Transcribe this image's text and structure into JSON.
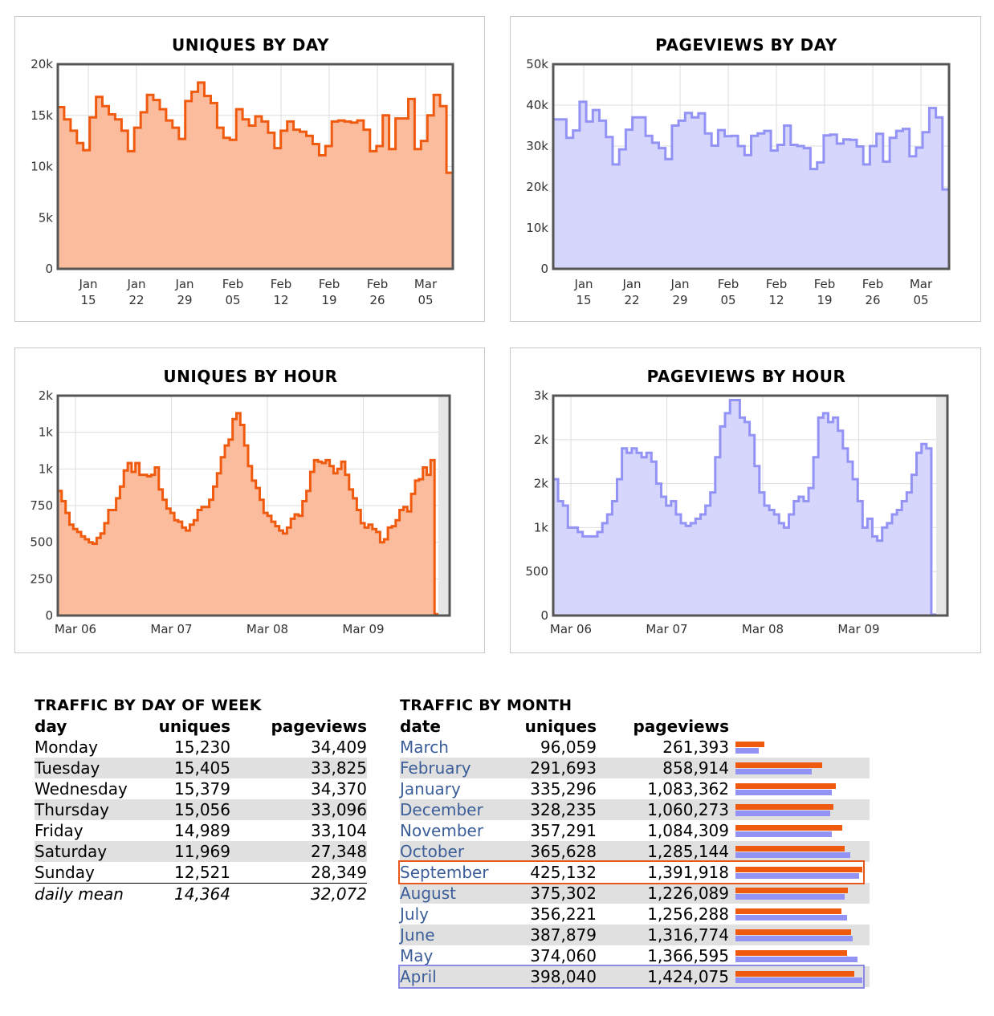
{
  "colors": {
    "uniques_line": "#f05a0e",
    "uniques_fill": "#fbbc9d",
    "pageviews_line": "#9393f5",
    "pageviews_fill": "#d6d6fd"
  },
  "chart_data": [
    {
      "id": "uniques_day",
      "type": "area",
      "title": "UNIQUES BY DAY",
      "yticks": [
        "0",
        "5k",
        "10k",
        "15k",
        "20k"
      ],
      "ylim": [
        0,
        20000
      ],
      "xticks": [
        [
          "Jan",
          "15"
        ],
        [
          "Jan",
          "22"
        ],
        [
          "Jan",
          "29"
        ],
        [
          "Feb",
          "05"
        ],
        [
          "Feb",
          "12"
        ],
        [
          "Feb",
          "19"
        ],
        [
          "Feb",
          "26"
        ],
        [
          "Mar",
          "05"
        ]
      ],
      "grid": true,
      "values": [
        15800,
        14600,
        13500,
        12300,
        11600,
        14800,
        16800,
        15900,
        15100,
        14600,
        13500,
        11500,
        13800,
        15300,
        17000,
        16500,
        15600,
        14500,
        13800,
        12700,
        16400,
        17300,
        18200,
        16900,
        16200,
        13800,
        12800,
        12600,
        15600,
        14600,
        14000,
        14900,
        14400,
        13300,
        11800,
        13500,
        14400,
        13600,
        13400,
        13000,
        12200,
        11100,
        12000,
        14400,
        14500,
        14400,
        14300,
        14500,
        13600,
        11500,
        12000,
        15000,
        11700,
        14700,
        14700,
        16600,
        11700,
        12500,
        15000,
        17000,
        15900,
        9400
      ],
      "colorKey": "uniques"
    },
    {
      "id": "pageviews_day",
      "type": "area",
      "title": "PAGEVIEWS BY DAY",
      "yticks": [
        "0",
        "10k",
        "20k",
        "30k",
        "40k",
        "50k"
      ],
      "ylim": [
        0,
        50000
      ],
      "xticks": [
        [
          "Jan",
          "15"
        ],
        [
          "Jan",
          "22"
        ],
        [
          "Jan",
          "29"
        ],
        [
          "Feb",
          "05"
        ],
        [
          "Feb",
          "12"
        ],
        [
          "Feb",
          "19"
        ],
        [
          "Feb",
          "26"
        ],
        [
          "Mar",
          "05"
        ]
      ],
      "grid": true,
      "values": [
        36500,
        36500,
        32000,
        33800,
        40800,
        36000,
        38800,
        36200,
        32200,
        25500,
        29200,
        34000,
        37000,
        37000,
        32500,
        30800,
        29500,
        26800,
        35000,
        36200,
        38100,
        37000,
        38000,
        33100,
        30100,
        33900,
        32400,
        32500,
        30000,
        27800,
        32500,
        33100,
        33700,
        28900,
        30300,
        35000,
        30300,
        30000,
        29500,
        24400,
        26000,
        32600,
        32800,
        30600,
        31600,
        31500,
        29900,
        25500,
        30000,
        33000,
        26200,
        32000,
        33700,
        34200,
        27500,
        29600,
        33400,
        39300,
        37000,
        19400
      ],
      "colorKey": "pageviews"
    },
    {
      "id": "uniques_hour",
      "type": "area",
      "title": "UNIQUES BY HOUR",
      "yticks": [
        "0",
        "250",
        "500",
        "750",
        "1k",
        "1k",
        "2k"
      ],
      "ylim": [
        0,
        1500
      ],
      "xticks": [
        [
          "Mar 06"
        ],
        [
          "Mar 07"
        ],
        [
          "Mar 08"
        ],
        [
          "Mar 09"
        ]
      ],
      "grid": true,
      "values": [
        850,
        780,
        700,
        620,
        590,
        570,
        540,
        520,
        500,
        490,
        530,
        560,
        630,
        720,
        720,
        800,
        880,
        990,
        1040,
        980,
        1040,
        960,
        960,
        950,
        960,
        1010,
        860,
        790,
        730,
        700,
        650,
        640,
        600,
        580,
        620,
        650,
        720,
        740,
        740,
        790,
        880,
        970,
        1080,
        1160,
        1200,
        1340,
        1380,
        1300,
        1160,
        1020,
        920,
        870,
        790,
        700,
        680,
        640,
        610,
        580,
        560,
        600,
        660,
        690,
        680,
        780,
        850,
        980,
        1060,
        1050,
        1040,
        1060,
        1020,
        970,
        1000,
        1050,
        960,
        860,
        800,
        720,
        630,
        600,
        620,
        590,
        570,
        500,
        520,
        600,
        610,
        650,
        720,
        740,
        710,
        830,
        920,
        930,
        1010,
        960,
        1060,
        10
      ],
      "colorKey": "uniques"
    },
    {
      "id": "pageviews_hour",
      "type": "area",
      "title": "PAGEVIEWS BY HOUR",
      "yticks": [
        "0",
        "500",
        "1k",
        "2k",
        "2k",
        "3k"
      ],
      "ylim": [
        0,
        2500
      ],
      "xticks": [
        [
          "Mar 06"
        ],
        [
          "Mar 07"
        ],
        [
          "Mar 08"
        ],
        [
          "Mar 09"
        ]
      ],
      "grid": true,
      "values": [
        1550,
        1300,
        1250,
        1000,
        1000,
        950,
        900,
        900,
        900,
        950,
        1050,
        1150,
        1300,
        1550,
        1900,
        1850,
        1900,
        1850,
        1800,
        1850,
        1750,
        1500,
        1350,
        1250,
        1300,
        1150,
        1050,
        1020,
        1050,
        1100,
        1150,
        1250,
        1400,
        1800,
        2150,
        2300,
        2450,
        2450,
        2250,
        2200,
        2050,
        1700,
        1400,
        1250,
        1200,
        1150,
        1050,
        1000,
        1150,
        1300,
        1350,
        1300,
        1450,
        1800,
        2250,
        2300,
        2200,
        2250,
        2100,
        1900,
        1750,
        1550,
        1300,
        1000,
        1100,
        900,
        850,
        1000,
        1050,
        1150,
        1200,
        1300,
        1400,
        1600,
        1850,
        1950,
        1900,
        10
      ],
      "colorKey": "pageviews"
    }
  ],
  "dow": {
    "title": "TRAFFIC BY DAY OF WEEK",
    "headers": [
      "day",
      "uniques",
      "pageviews"
    ],
    "rows": [
      [
        "Monday",
        "15,230",
        "34,409"
      ],
      [
        "Tuesday",
        "15,405",
        "33,825"
      ],
      [
        "Wednesday",
        "15,379",
        "34,370"
      ],
      [
        "Thursday",
        "15,056",
        "33,096"
      ],
      [
        "Friday",
        "14,989",
        "33,104"
      ],
      [
        "Saturday",
        "11,969",
        "27,348"
      ],
      [
        "Sunday",
        "12,521",
        "28,349"
      ]
    ],
    "mean": [
      "daily mean",
      "14,364",
      "32,072"
    ]
  },
  "month": {
    "title": "TRAFFIC BY MONTH",
    "headers": [
      "date",
      "uniques",
      "pageviews"
    ],
    "rows": [
      [
        "March",
        "96,059",
        "261,393",
        96059,
        261393
      ],
      [
        "February",
        "291,693",
        "858,914",
        291693,
        858914
      ],
      [
        "January",
        "335,296",
        "1,083,362",
        335296,
        1083362
      ],
      [
        "December",
        "328,235",
        "1,060,273",
        328235,
        1060273
      ],
      [
        "November",
        "357,291",
        "1,084,309",
        357291,
        1084309
      ],
      [
        "October",
        "365,628",
        "1,285,144",
        365628,
        1285144
      ],
      [
        "September",
        "425,132",
        "1,391,918",
        425132,
        1391918
      ],
      [
        "August",
        "375,302",
        "1,226,089",
        375302,
        1226089
      ],
      [
        "July",
        "356,221",
        "1,256,288",
        356221,
        1256288
      ],
      [
        "June",
        "387,879",
        "1,316,774",
        387879,
        1316774
      ],
      [
        "May",
        "374,060",
        "1,366,595",
        374060,
        1366595
      ],
      [
        "April",
        "398,040",
        "1,424,075",
        398040,
        1424075
      ]
    ],
    "max_uniques_row": 6,
    "max_pageviews_row": 11
  }
}
